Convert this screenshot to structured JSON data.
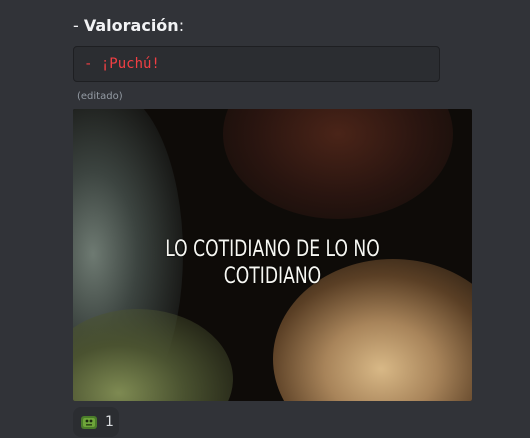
{
  "message": {
    "heading_prefix": "- ",
    "heading_bold": "Valoración",
    "heading_suffix": ":",
    "code_text": "- ¡Puchú!",
    "edited_label": "(editado)"
  },
  "embed": {
    "caption_line1": "LO COTIDIANO DE LO NO",
    "caption_line2": "COTIDIANO"
  },
  "reaction": {
    "emoji": "green-creature-emoji",
    "count": "1"
  },
  "colors": {
    "background": "#313338",
    "code_block_bg": "#2b2d31",
    "code_text": "#f23f43",
    "muted_text": "#949ba4"
  }
}
